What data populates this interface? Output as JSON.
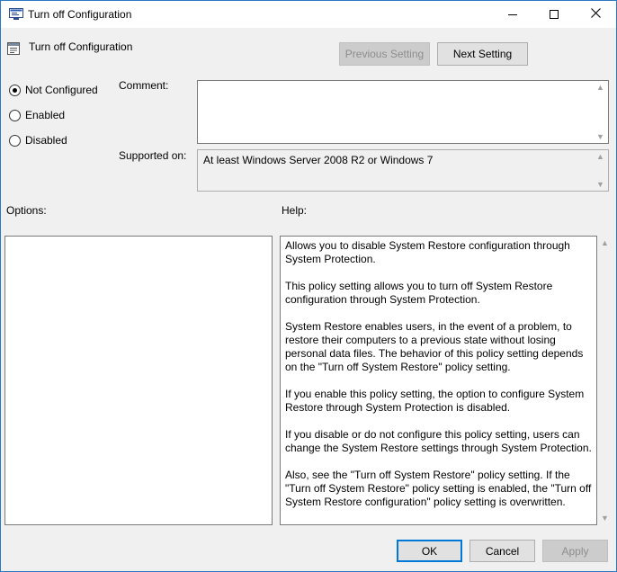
{
  "window": {
    "title": "Turn off Configuration",
    "colors": {
      "accent": "#0078d7",
      "frame": "#2b79c2",
      "background": "#f0f0f0"
    },
    "icons": {
      "app": "policy-icon",
      "minimize": "minimize-icon",
      "maximize": "maximize-icon",
      "close": "close-icon"
    }
  },
  "header": {
    "title": "Turn off Configuration",
    "previous_label": "Previous Setting",
    "next_label": "Next Setting"
  },
  "state": {
    "options": [
      {
        "label": "Not Configured",
        "checked": true
      },
      {
        "label": "Enabled",
        "checked": false
      },
      {
        "label": "Disabled",
        "checked": false
      }
    ]
  },
  "comment": {
    "label": "Comment:",
    "value": ""
  },
  "supported": {
    "label": "Supported on:",
    "value": "At least Windows Server 2008 R2 or Windows 7"
  },
  "options_label": "Options:",
  "help": {
    "label": "Help:",
    "paragraphs": [
      "Allows you to disable System Restore configuration through System Protection.",
      "This policy setting allows you to turn off System Restore configuration through System Protection.",
      "System Restore enables users, in the event of a problem, to restore their computers to a previous state without losing personal data files. The behavior of this policy setting depends on the \"Turn off System Restore\" policy setting.",
      "If you enable this policy setting, the option to configure System Restore through System Protection is disabled.",
      "If you disable or do not configure this policy setting, users can change the System Restore settings through System Protection.",
      "Also, see the \"Turn off System Restore\" policy setting. If the \"Turn off System Restore\" policy setting is enabled, the \"Turn off System Restore configuration\" policy setting is overwritten."
    ]
  },
  "footer": {
    "ok_label": "OK",
    "cancel_label": "Cancel",
    "apply_label": "Apply"
  }
}
